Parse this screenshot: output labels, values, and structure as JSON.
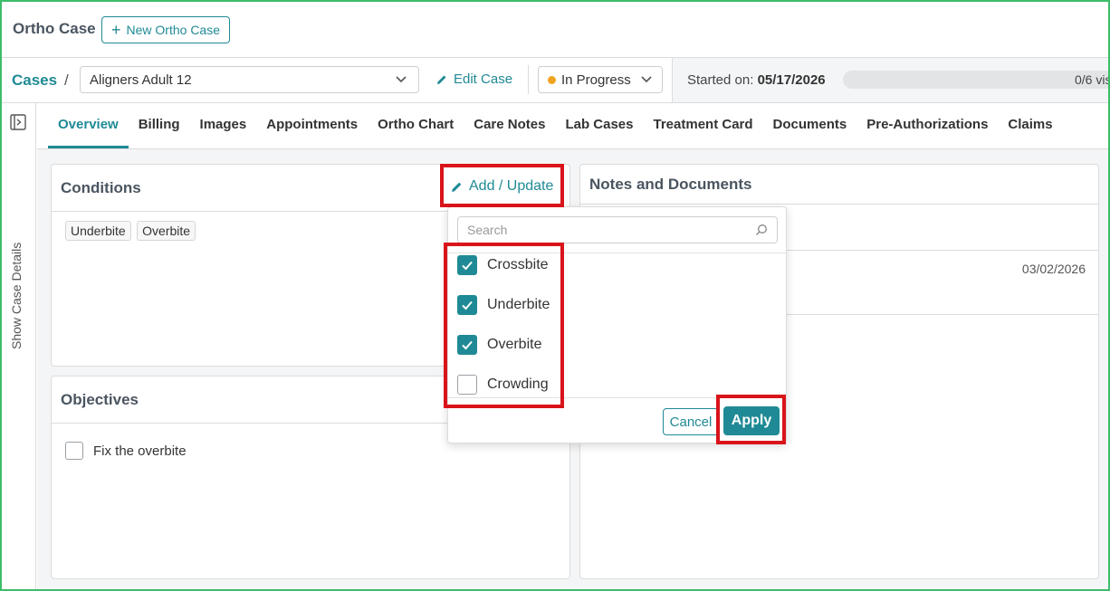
{
  "header": {
    "app_title": "Ortho Case",
    "new_case_label": "New Ortho Case"
  },
  "case_bar": {
    "breadcrumb_root": "Cases",
    "breadcrumb_sep": "/",
    "case_name": "Aligners Adult 12",
    "edit_label": "Edit Case",
    "status": "In Progress",
    "started_label": "Started on:",
    "started_date": "05/17/2026",
    "progress_text": "0/6 vis",
    "progress_fraction": 0
  },
  "side": {
    "label": "Show Case Details"
  },
  "tabs": [
    {
      "label": "Overview"
    },
    {
      "label": "Billing"
    },
    {
      "label": "Images"
    },
    {
      "label": "Appointments"
    },
    {
      "label": "Ortho Chart"
    },
    {
      "label": "Care Notes"
    },
    {
      "label": "Lab Cases"
    },
    {
      "label": "Treatment Card"
    },
    {
      "label": "Documents"
    },
    {
      "label": "Pre-Authorizations"
    },
    {
      "label": "Claims"
    }
  ],
  "conditions": {
    "title": "Conditions",
    "add_update_label": "Add / Update",
    "tags": [
      "Underbite",
      "Overbite"
    ]
  },
  "objectives": {
    "title": "Objectives",
    "items": [
      {
        "label": "Fix the overbite",
        "checked": false
      }
    ]
  },
  "notes": {
    "title": "Notes and Documents",
    "row_date": "03/02/2026"
  },
  "dropdown": {
    "search_placeholder": "Search",
    "options": [
      {
        "label": "Crossbite",
        "checked": true
      },
      {
        "label": "Underbite",
        "checked": true
      },
      {
        "label": "Overbite",
        "checked": true
      },
      {
        "label": "Crowding",
        "checked": false
      }
    ],
    "cancel_label": "Cancel",
    "apply_label": "Apply"
  },
  "colors": {
    "accent": "#1f8a95",
    "status_dot": "#f0a321",
    "highlight": "#d9141a",
    "frame": "#3dbd6a"
  }
}
